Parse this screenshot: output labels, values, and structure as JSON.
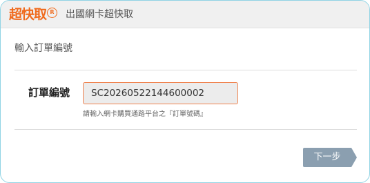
{
  "header": {
    "logo_text": "超快取",
    "logo_badge": "R",
    "title": "出國網卡超快取"
  },
  "section": {
    "title": "輸入訂單編號"
  },
  "form": {
    "order_label": "訂單編號",
    "order_value": "SC20260522144600002",
    "hint": "請輸入網卡購買通路平台之『訂單號碼』"
  },
  "actions": {
    "next_label": "下一步"
  },
  "colors": {
    "brand": "#f06a1c",
    "card_border": "#8fd3e4",
    "input_border": "#f0814c",
    "button": "#8b9fb0"
  }
}
